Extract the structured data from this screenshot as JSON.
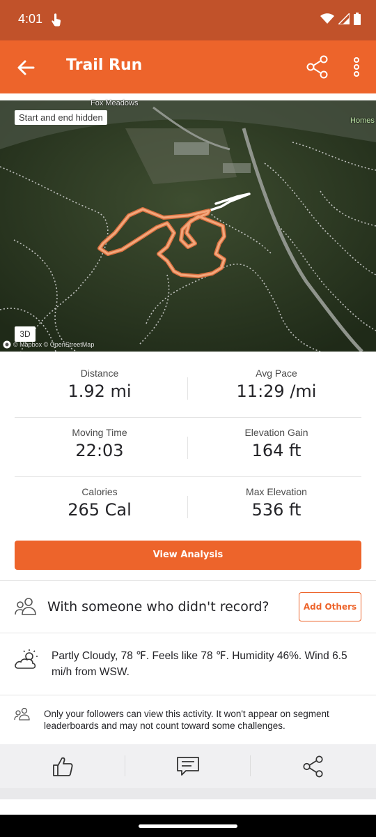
{
  "status_bar": {
    "time": "4:01",
    "icons": [
      "touch-icon",
      "wifi-icon",
      "signal-icon",
      "battery-icon"
    ]
  },
  "app_bar": {
    "title": "Trail Run",
    "icons": [
      "back-arrow-icon",
      "share-icon",
      "more-vert-icon"
    ],
    "background": "#ed642b"
  },
  "map": {
    "chip_label": "Start and end hidden",
    "place_labels": [
      "Fox Meadows",
      "Homes"
    ],
    "toggle_3d": "3D",
    "attribution": "© Mapbox © OpenStreetMap",
    "route_color": "#f39a6a"
  },
  "stats": [
    {
      "label": "Distance",
      "value": "1.92 mi"
    },
    {
      "label": "Avg Pace",
      "value": "11:29 /mi"
    },
    {
      "label": "Moving Time",
      "value": "22:03"
    },
    {
      "label": "Elevation Gain",
      "value": "164 ft"
    },
    {
      "label": "Calories",
      "value": "265 Cal"
    },
    {
      "label": "Max Elevation",
      "value": "536 ft"
    }
  ],
  "view_analysis_label": "View Analysis",
  "with_others": {
    "text": "With someone who didn't record?",
    "button_label": "Add Others"
  },
  "weather": {
    "text": "Partly Cloudy, 78 ℉. Feels like 78 ℉. Humidity 46%. Wind 6.5 mi/h from WSW."
  },
  "privacy": {
    "text": "Only your followers can view this activity. It won't appear on segment leaderboards and may not count toward some challenges."
  },
  "actions": [
    "like-icon",
    "comment-icon",
    "share-icon"
  ],
  "colors": {
    "accent": "#ed642b",
    "status_bar": "#c1522a"
  }
}
